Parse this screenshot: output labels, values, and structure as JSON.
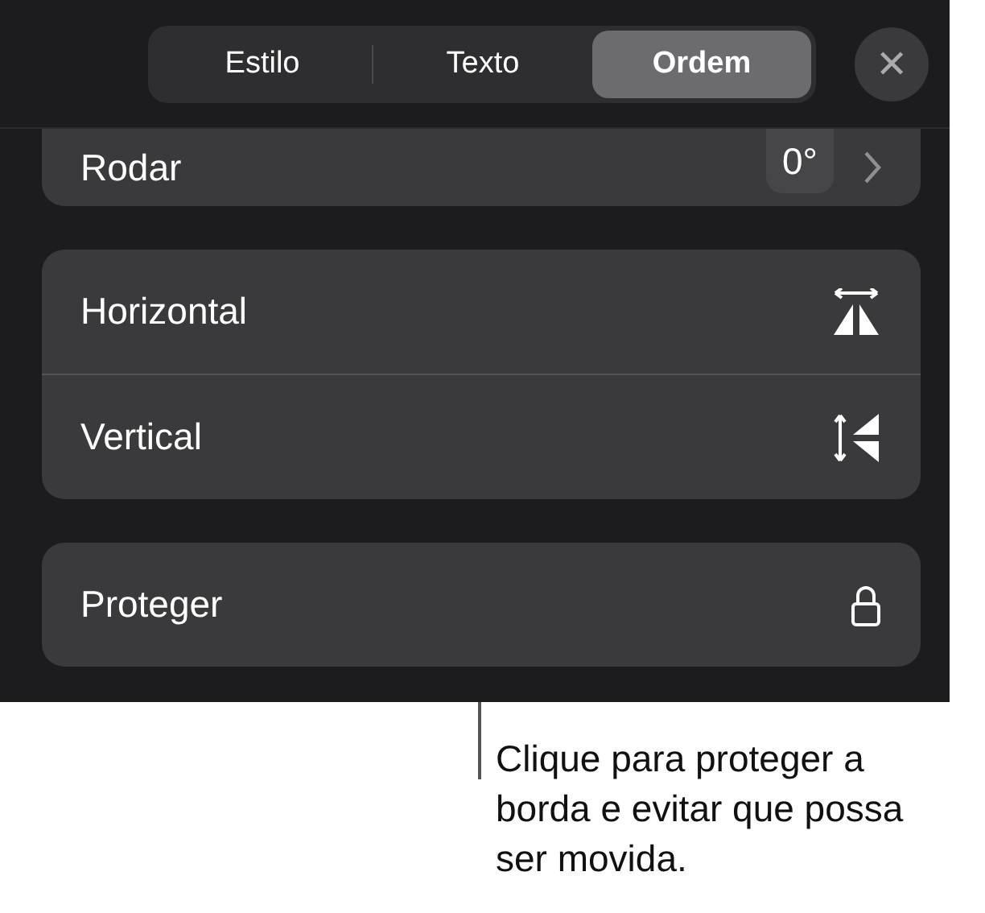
{
  "tabs": [
    {
      "label": "Estilo",
      "selected": false
    },
    {
      "label": "Texto",
      "selected": false
    },
    {
      "label": "Ordem",
      "selected": true
    }
  ],
  "close": {
    "label": "✕"
  },
  "rotate": {
    "label": "Rodar",
    "value": "0°"
  },
  "flip": [
    {
      "label": "Horizontal",
      "kind": "horizontal"
    },
    {
      "label": "Vertical",
      "kind": "vertical"
    }
  ],
  "lock": {
    "label": "Proteger"
  },
  "callout": {
    "text": "Clique para proteger a borda e evitar que possa ser movida."
  }
}
